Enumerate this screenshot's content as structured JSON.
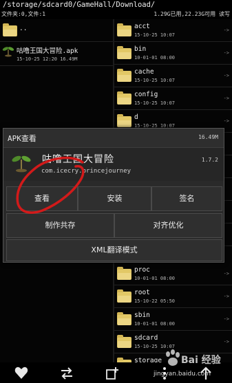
{
  "path": "/storage/sdcard0/GameHall/Download/",
  "status": {
    "left": "文件夹:0,文件:1",
    "right": "1.29G已用,22.23G可用 读写"
  },
  "left_pane": {
    "items": [
      {
        "name": "..",
        "date": ""
      },
      {
        "name": "咕噜王国大冒险.apk",
        "date": "15-10-25 12:20 16.49M"
      }
    ]
  },
  "right_pane": {
    "items": [
      {
        "name": "acct",
        "date": "15-10-25 10:07"
      },
      {
        "name": "bin",
        "date": "10-01-01 08:00"
      },
      {
        "name": "cache",
        "date": "15-10-25 10:07"
      },
      {
        "name": "config",
        "date": "15-10-25 10:07"
      },
      {
        "name": "d",
        "date": "15-10-25 10:07"
      },
      {
        "name": "proc",
        "date": "10-01-01 08:00"
      },
      {
        "name": "root",
        "date": "15-10-22 05:50"
      },
      {
        "name": "sbin",
        "date": "10-01-01 08:00"
      },
      {
        "name": "sdcard",
        "date": "15-10-25 10:07"
      },
      {
        "name": "storage",
        "date": ""
      }
    ]
  },
  "dialog": {
    "title": "APK查看",
    "size": "16.49M",
    "app_name": "咕噜王国大冒险",
    "package": "com.icecry.princejourney",
    "version": "1.7.2",
    "buttons": {
      "view": "查看",
      "install": "安装",
      "sign": "签名",
      "make_shared": "制作共存",
      "align": "对齐优化",
      "xml_translate": "XML翻译模式"
    }
  },
  "watermark": {
    "brand": "Bai 经验",
    "url": "jingyan.baidu.com"
  },
  "colors": {
    "folder": "#e2c866",
    "accent_mark": "#d21a1a",
    "background": "#000000"
  }
}
